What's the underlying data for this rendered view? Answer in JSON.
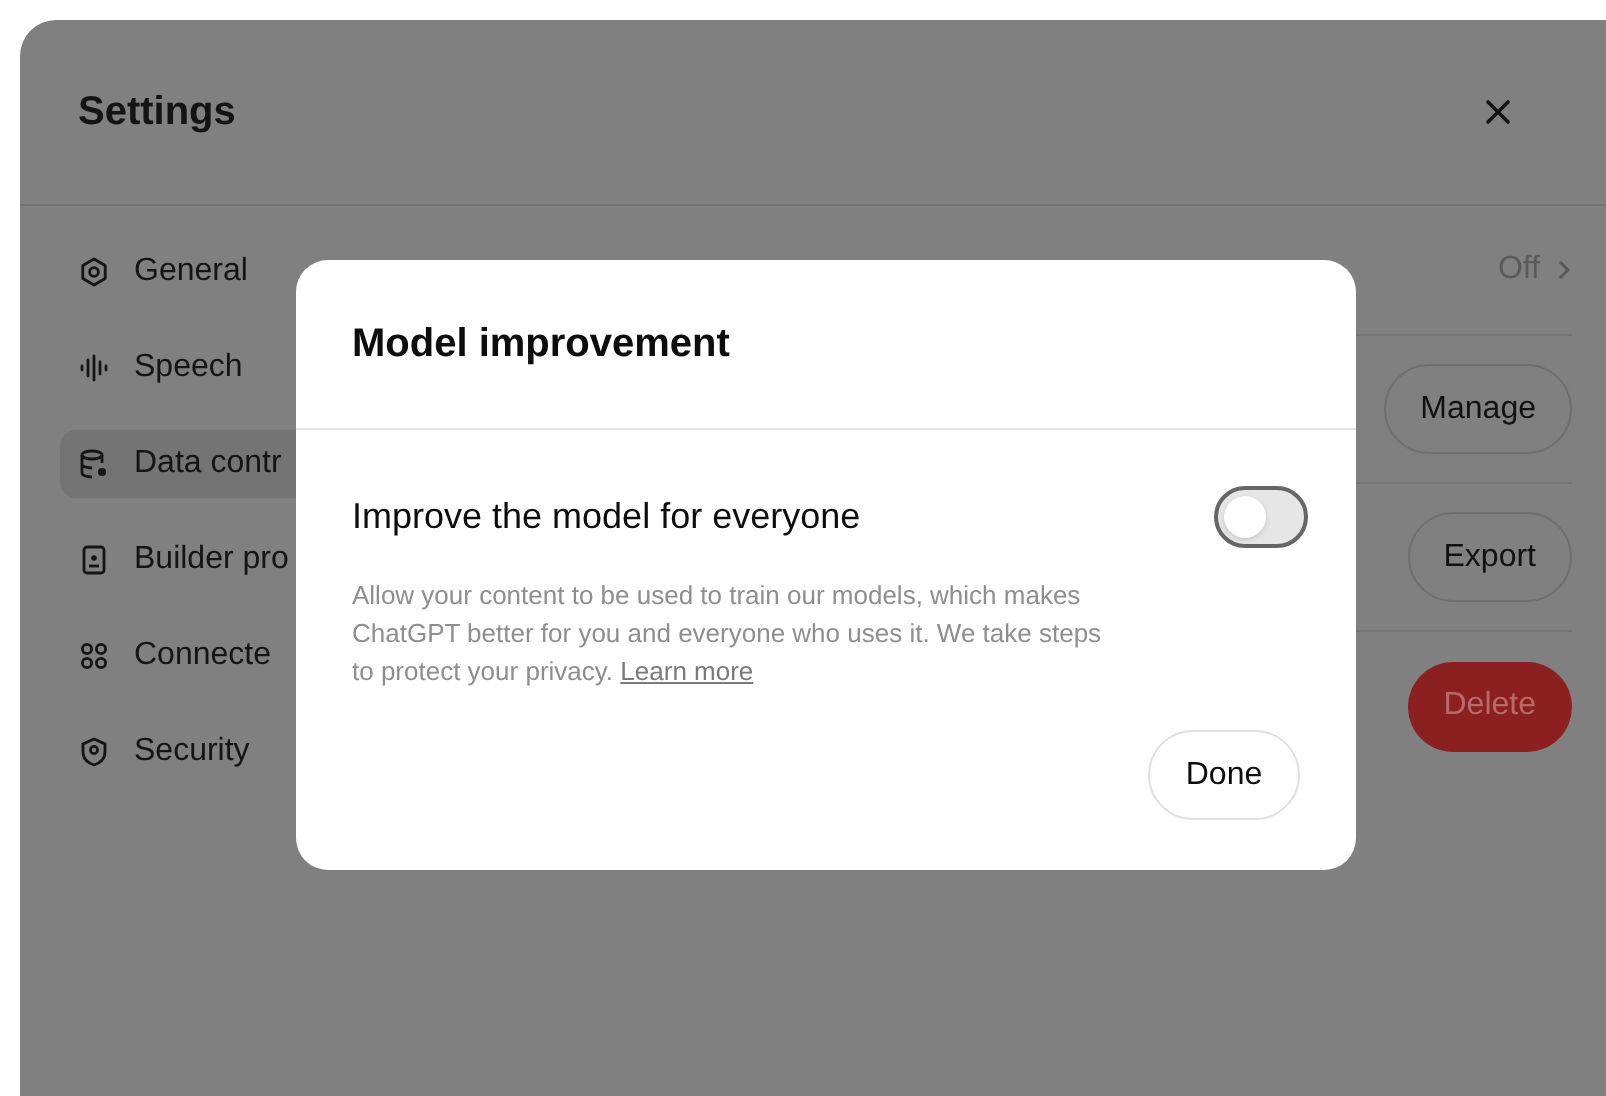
{
  "window": {
    "title": "Settings"
  },
  "sidebar": {
    "items": [
      {
        "label": "General",
        "selected": false
      },
      {
        "label": "Speech",
        "selected": false
      },
      {
        "label": "Data contr",
        "selected": true
      },
      {
        "label": "Builder pro",
        "selected": false
      },
      {
        "label": "Connecte",
        "selected": false
      },
      {
        "label": "Security",
        "selected": false
      }
    ]
  },
  "rows": [
    {
      "kind": "value",
      "text": "Off"
    },
    {
      "kind": "button",
      "text": "Manage"
    },
    {
      "kind": "button",
      "text": "Export"
    },
    {
      "kind": "danger",
      "text": "Delete"
    }
  ],
  "dialog": {
    "title": "Model improvement",
    "setting": {
      "label": "Improve the model for everyone",
      "on": false
    },
    "description": "Allow your content to be used to train our models, which makes ChatGPT better for you and everyone who uses it. We take steps to protect your privacy.",
    "link": "Learn more",
    "done": "Done"
  }
}
